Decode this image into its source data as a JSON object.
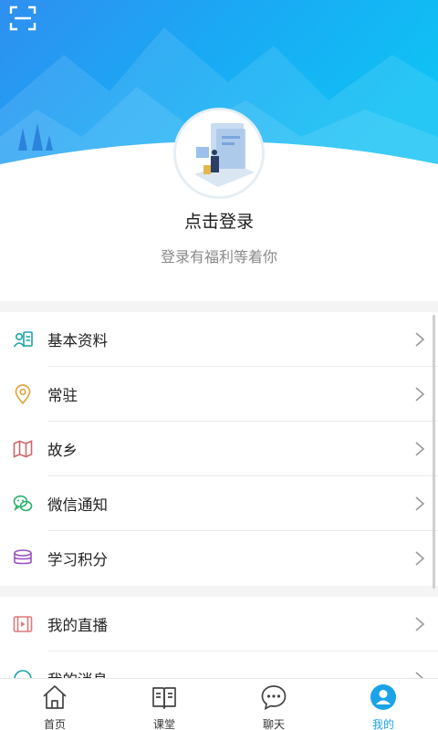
{
  "header": {
    "scan_icon": "scan-icon"
  },
  "profile": {
    "login_title": "点击登录",
    "login_subtitle": "登录有福利等着你",
    "avatar_icon": "avatar-illustration"
  },
  "menu_group_1": [
    {
      "label": "基本资料",
      "icon": "profile-card-icon",
      "color": "#1aa3a8"
    },
    {
      "label": "常驻",
      "icon": "location-pin-icon",
      "color": "#e0a640"
    },
    {
      "label": "故乡",
      "icon": "map-icon",
      "color": "#d0676b"
    },
    {
      "label": "微信通知",
      "icon": "wechat-icon",
      "color": "#2bb36b"
    },
    {
      "label": "学习积分",
      "icon": "coins-stack-icon",
      "color": "#9b4fc1"
    }
  ],
  "menu_group_2": [
    {
      "label": "我的直播",
      "icon": "video-icon",
      "color": "#e07a7a"
    },
    {
      "label": "我的消息",
      "icon": "message-icon",
      "color": "#1aa3a8"
    }
  ],
  "tabbar": {
    "tabs": [
      {
        "label": "首页",
        "icon": "home-icon"
      },
      {
        "label": "课堂",
        "icon": "book-icon"
      },
      {
        "label": "聊天",
        "icon": "chat-bubble-icon"
      },
      {
        "label": "我的",
        "icon": "user-icon",
        "active": true
      }
    ],
    "active_color": "#1aa3e8"
  },
  "colors": {
    "header_top": "#2f9cf0",
    "header_mid": "#12b6f3",
    "accent": "#1aa3e8"
  }
}
